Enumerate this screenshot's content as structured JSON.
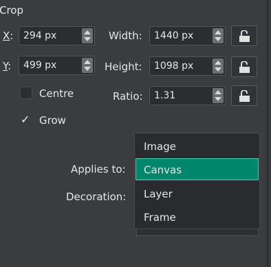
{
  "panel": {
    "title": "Crop",
    "x": {
      "letter": "X",
      "suffix": ":",
      "value": "294 px"
    },
    "y": {
      "letter": "Y",
      "suffix": ":",
      "value": "499 px"
    },
    "width": {
      "label": "Width:",
      "value": "1440 px"
    },
    "height": {
      "label": "Height:",
      "value": "1098 px"
    },
    "ratio": {
      "label": "Ratio:",
      "value": "1.31"
    },
    "centre": {
      "label": "Centre",
      "checked": false
    },
    "grow": {
      "label": "Grow",
      "checked": true,
      "mark": "✓"
    },
    "applies_to_label": "Applies to:",
    "decoration_label": "Decoration:"
  },
  "dropdown": {
    "options": [
      "Image",
      "Canvas",
      "Layer",
      "Frame"
    ],
    "selected": "Canvas"
  },
  "colors": {
    "accent": "#00876b"
  }
}
